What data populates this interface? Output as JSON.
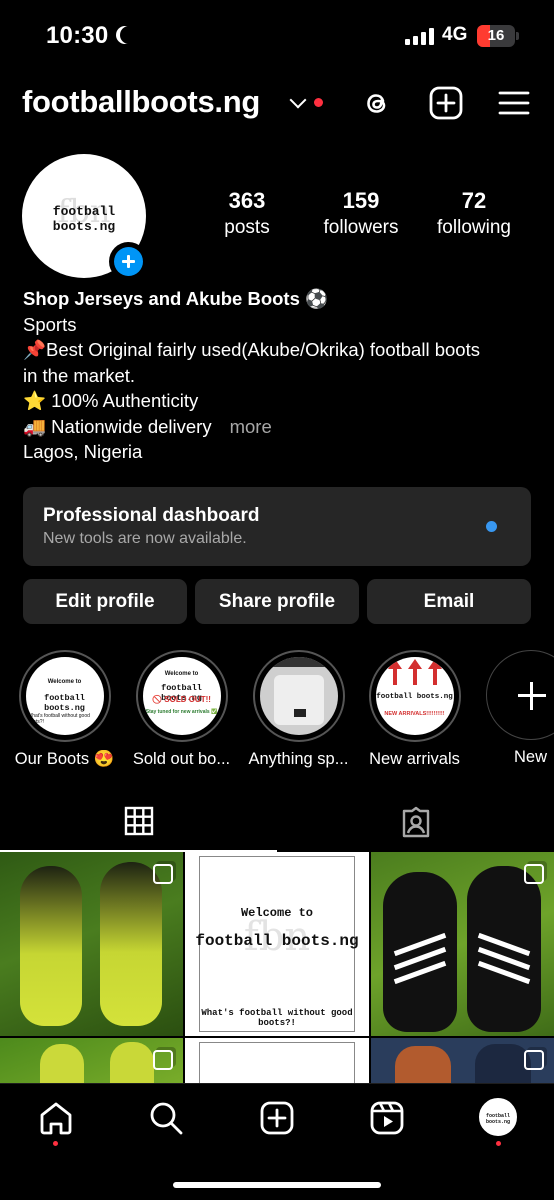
{
  "status_bar": {
    "time": "10:30",
    "network": "4G",
    "battery": "16",
    "battery_level": 0.16
  },
  "header": {
    "username": "footballboots.ng"
  },
  "profile": {
    "avatar_text": "football boots.ng",
    "avatar_watermark": "fbn",
    "stats": [
      {
        "value": "363",
        "label": "posts"
      },
      {
        "value": "159",
        "label": "followers"
      },
      {
        "value": "72",
        "label": "following"
      }
    ],
    "bio": {
      "name": "Shop Jerseys and Akube Boots ⚽️",
      "category": "Sports",
      "line1": "📌Best Original fairly used(Akube/Okrika) football boots in the market.",
      "line2": "⭐️ 100% Authenticity",
      "line3": "🚚 Nationwide delivery",
      "more": "more",
      "location": "Lagos, Nigeria"
    }
  },
  "dashboard": {
    "title": "Professional dashboard",
    "subtitle": "New tools are now available."
  },
  "actions": {
    "edit": "Edit profile",
    "share": "Share profile",
    "email": "Email"
  },
  "highlights": [
    {
      "label": "Our Boots 😍",
      "heading": "Welcome to",
      "title": "football boots.ng",
      "footer": "What's football without good boots?!"
    },
    {
      "label": "Sold out bo...",
      "heading": "Welcome to",
      "title": "football boots.ng",
      "badge": "🚫 SOLD OUT!!",
      "footer": "Stay tuned for new arrivals ✅"
    },
    {
      "label": "Anything sp...",
      "footer": ""
    },
    {
      "label": "New arrivals",
      "title": "football boots.ng",
      "badge": "NEW ARRIVALS!!!!!!!!!!"
    },
    {
      "label": "New"
    }
  ],
  "tabs": [
    {
      "name": "posts-grid"
    },
    {
      "name": "tagged"
    }
  ],
  "grid_posts": {
    "welcome": "Welcome to",
    "title": "football boots.ng",
    "watermark": "fbn",
    "footer": "What's football without good boots?!"
  },
  "colors": {
    "accent": "#0095f6",
    "notification": "#ff3040",
    "card": "#262626",
    "secondary_text": "#a8a8a8"
  }
}
